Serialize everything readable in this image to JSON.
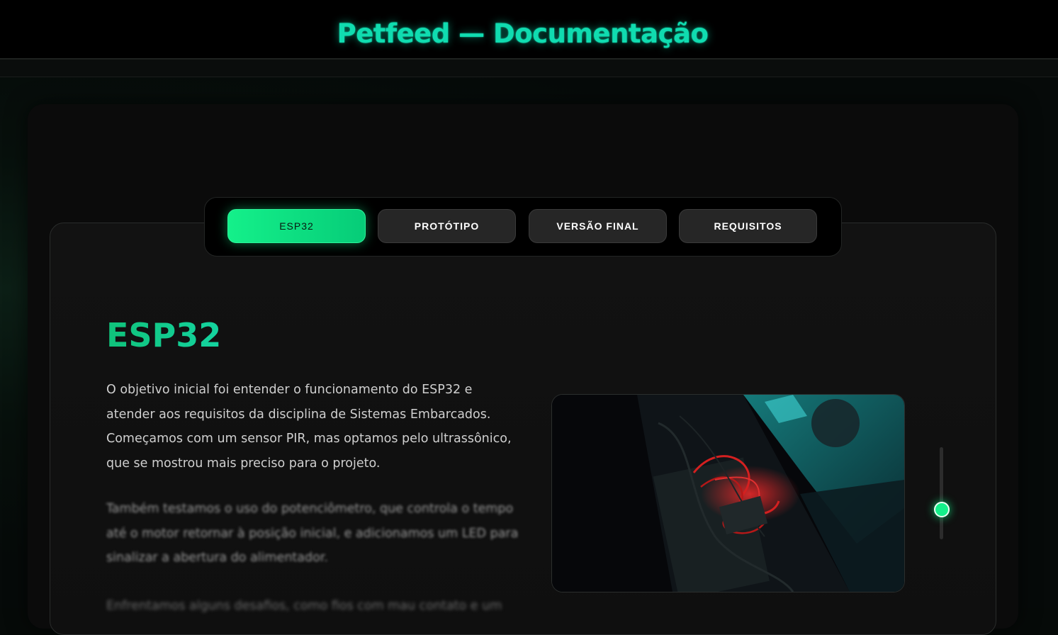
{
  "header": {
    "title": "Petfeed — Documentação"
  },
  "tabs": [
    {
      "label": "ESP32",
      "active": true
    },
    {
      "label": "PROTÓTIPO",
      "active": false
    },
    {
      "label": "VERSÃO FINAL",
      "active": false
    },
    {
      "label": "REQUISITOS",
      "active": false
    }
  ],
  "section": {
    "title": "ESP32",
    "paragraphs": [
      "O objetivo inicial foi entender o funcionamento do ESP32 e atender aos requisitos da disciplina de Sistemas Embarcados. Começamos com um sensor PIR, mas optamos pelo ultrassônico, que se mostrou mais preciso para o projeto.",
      "Também testamos o uso do potenciômetro, que controla o tempo até o motor retornar à posição inicial, e adicionamos um LED para sinalizar a abertura do alimentador.",
      "Enfrentamos alguns desafios, como fios com mau contato e um"
    ]
  },
  "scroll_slider": {
    "position_fraction": 0.68
  },
  "colors": {
    "accent": "#14f08a",
    "title_glow": "#10dcb0"
  }
}
